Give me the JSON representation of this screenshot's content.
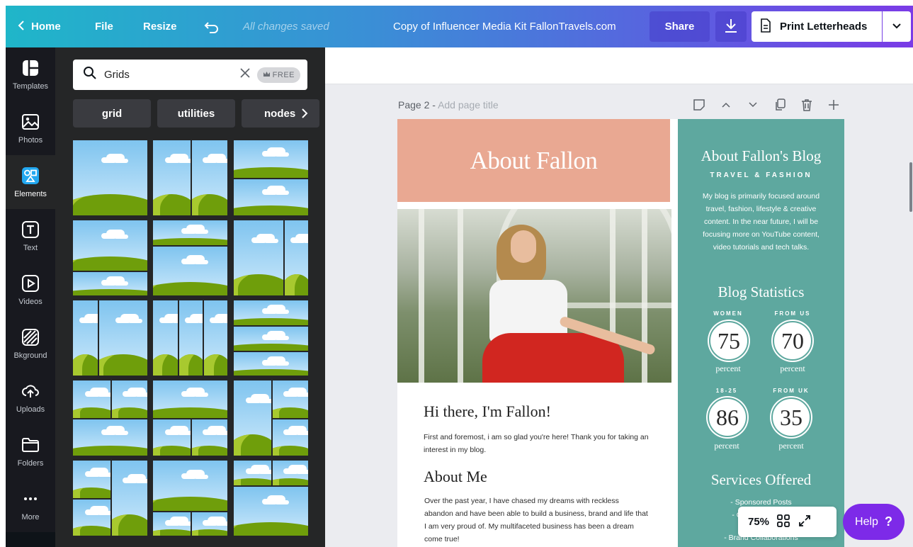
{
  "topbar": {
    "home": "Home",
    "file": "File",
    "resize": "Resize",
    "saved_status": "All changes saved",
    "doc_title": "Copy of Influencer Media Kit FallonTravels.com",
    "share": "Share",
    "print": "Print Letterheads"
  },
  "rail": {
    "templates": "Templates",
    "photos": "Photos",
    "elements": "Elements",
    "text": "Text",
    "videos": "Videos",
    "background": "Bkground",
    "uploads": "Uploads",
    "folders": "Folders",
    "more": "More"
  },
  "panel": {
    "search_value": "Grids",
    "free_badge": "FREE",
    "chips": [
      "grid",
      "utilities",
      "nodes"
    ]
  },
  "page": {
    "label": "Page 2 -",
    "title_placeholder": "Add page title"
  },
  "design": {
    "about_header": "About Fallon",
    "greeting": "Hi there, I'm Fallon!",
    "greeting_body": "First and foremost, i am so glad you're here! Thank you for taking an interest in my blog.",
    "about_me": "About Me",
    "about_me_body": "Over the past year, I have chased my dreams with reckless abandon and have been able to build a business, brand and life that I am very proud of. My multifaceted business has been a dream come true!",
    "blog_title": "About Fallon's Blog",
    "blog_tagline": "TRAVEL & FASHION",
    "blog_body": "My blog is primarily focused around travel, fashion, lifestyle & creative content. In the near future, I will be focusing more on YouTube content, video tutorials and tech talks.",
    "stats_title": "Blog Statistics",
    "stats": [
      {
        "label": "WOMEN",
        "value": "75",
        "unit": "percent"
      },
      {
        "label": "FROM US",
        "value": "70",
        "unit": "percent"
      },
      {
        "label": "18-25",
        "value": "86",
        "unit": "percent"
      },
      {
        "label": "FROM UK",
        "value": "35",
        "unit": "percent"
      }
    ],
    "services_title": "Services Offered",
    "services": [
      "- Sponsored Posts",
      "- Custom Content",
      "- Brand Collaborations"
    ]
  },
  "zoom": "75%",
  "help": {
    "label": "Help",
    "mark": "?"
  }
}
